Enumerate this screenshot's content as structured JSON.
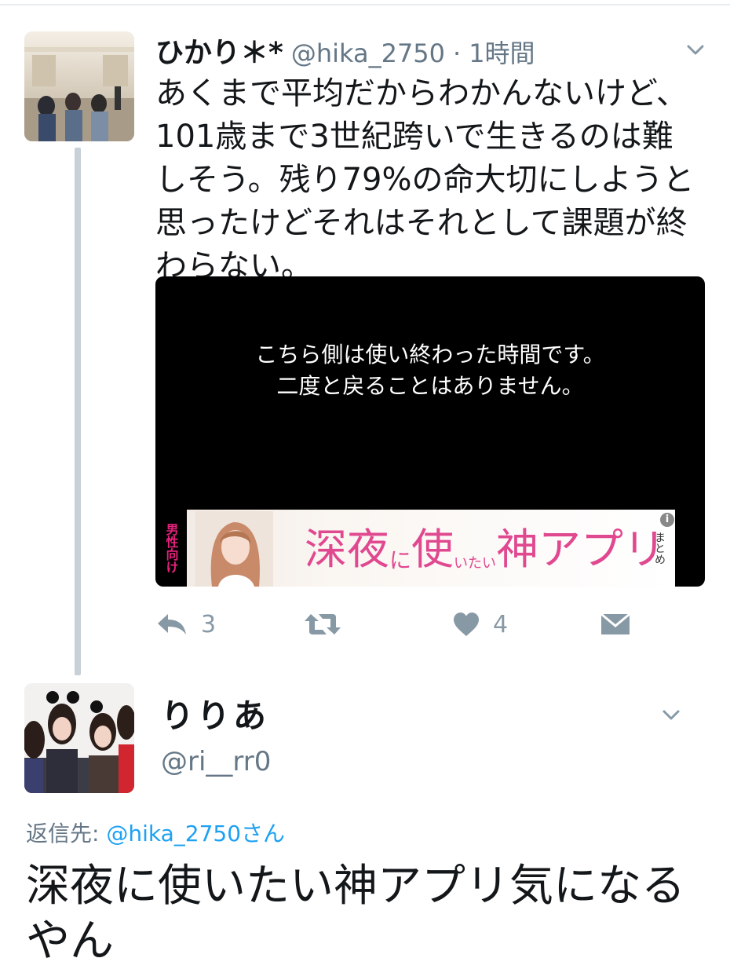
{
  "tweet1": {
    "display_name": "ひかり＊*",
    "handle": "@hika_2750",
    "separator": "·",
    "time": "1時間",
    "text": "あくまで平均だからわかんないけど、\n101歳まで3世紀跨いで生きるのは難\nしそう。残り79%の命大切にしようと\n思ったけどそれはそれとして課題が終\nわらない。",
    "media": {
      "caption": "こちら側は使い終わった時間です。\n二度と戻ることはありません。",
      "ad": {
        "tag": "男性向け",
        "title_part1": "深夜",
        "title_part2": "に",
        "title_part3": "使",
        "title_part4": "いたい",
        "title_part5": "神アプリ",
        "suffix": "まとめ",
        "info": "i"
      }
    },
    "actions": {
      "reply_count": "3",
      "like_count": "4"
    },
    "icons": [
      "reply-icon",
      "retweet-icon",
      "heart-icon",
      "direct-message-icon",
      "chevron-down-icon"
    ]
  },
  "tweet2": {
    "display_name": "りりあ",
    "handle": "@ri__rr0",
    "reply_label": "返信先:",
    "reply_mention": "@hika_2750",
    "reply_suffix": "さん",
    "text": "深夜に使いたい神アプリ気になる\nやん"
  },
  "colors": {
    "text": "#14171a",
    "secondary": "#657786",
    "link": "#1da1f2",
    "icon": "#8899a6",
    "thread_line": "#c8d0d8",
    "ad_pink": "#e0488f"
  }
}
